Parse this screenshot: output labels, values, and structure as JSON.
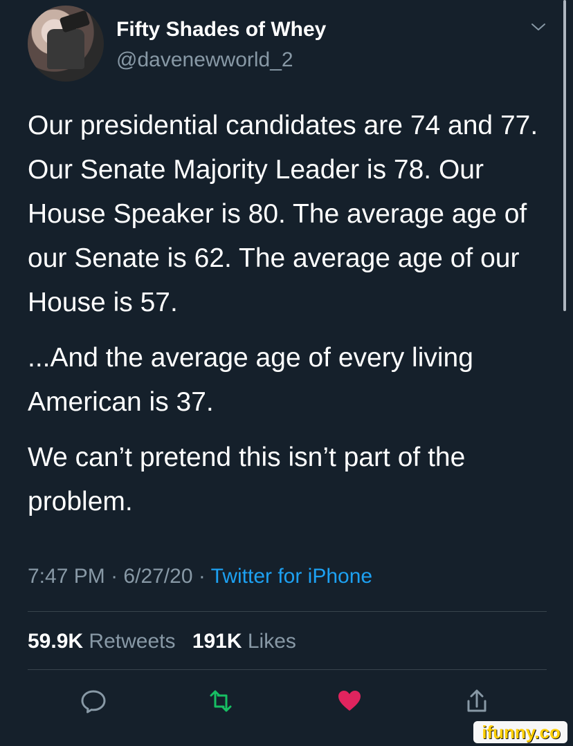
{
  "header": {
    "display_name": "Fifty Shades of Whey",
    "handle": "@davenewworld_2"
  },
  "tweet": {
    "paragraphs": [
      "Our presidential candidates are 74 and 77. Our Senate Majority Leader is 78. Our House Speaker is 80. The average age of our Senate is 62. The average age of our House is 57.",
      "...And the average age of every living American is 37.",
      "We can’t pretend this isn’t part of the problem."
    ],
    "time": "7:47 PM",
    "date": "6/27/20",
    "separator": "·",
    "source": "Twitter for iPhone"
  },
  "stats": {
    "retweets_count": "59.9K",
    "retweets_label": "Retweets",
    "likes_count": "191K",
    "likes_label": "Likes"
  },
  "actions": {
    "reply_icon": "reply-icon",
    "retweet_icon": "retweet-icon",
    "like_icon": "heart-icon",
    "share_icon": "share-icon"
  },
  "watermark": {
    "text": "ifunny.co"
  },
  "colors": {
    "background": "#15202b",
    "text": "#ffffff",
    "muted": "#8899a6",
    "link": "#1da1f2",
    "retweet": "#17bf63",
    "like": "#e0245e",
    "divider": "#38444d"
  }
}
